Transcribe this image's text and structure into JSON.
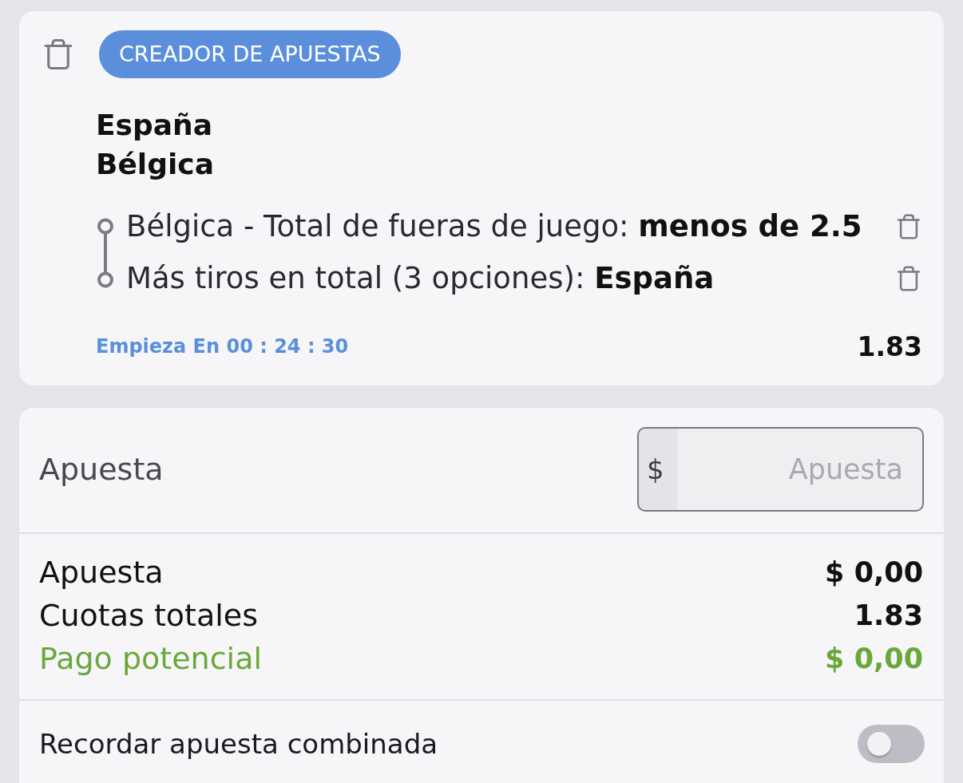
{
  "bet_slip": {
    "badge": "CREADOR DE APUESTAS",
    "teams": [
      "España",
      "Bélgica"
    ],
    "selections": [
      {
        "text": "Bélgica - Total de fueras de juego: **menos de 2.5**"
      },
      {
        "text": "Más tiros en total (3 opciones): **España**"
      }
    ],
    "countdown": "Empieza En 00 : 24 : 30",
    "odds": "1.83"
  },
  "stake": {
    "label": "Apuesta",
    "currency": "$",
    "placeholder": "Apuesta"
  },
  "summary": [
    {
      "label": "Apuesta",
      "value": "$ 0,00",
      "kind": "normal"
    },
    {
      "label": "Cuotas totales",
      "value": "1.83",
      "kind": "normal"
    },
    {
      "label": "Pago potencial",
      "value": "$ 0,00",
      "kind": "payout"
    }
  ],
  "remember": {
    "label": "Recordar apuesta combinada",
    "on": false
  }
}
